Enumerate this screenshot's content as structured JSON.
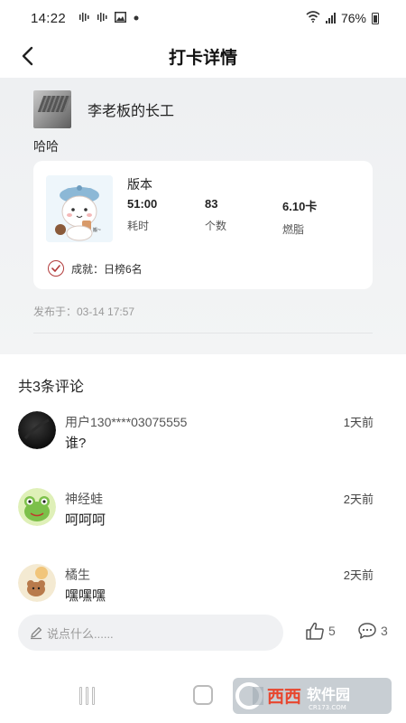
{
  "status_bar": {
    "time": "14:22",
    "icons_left": [
      "notification-icon",
      "notification-icon",
      "gallery-icon",
      "dot-icon"
    ],
    "icons_right": [
      "wifi-icon",
      "signal-icon"
    ],
    "battery": "76%"
  },
  "header": {
    "title": "打卡详情",
    "back_icon": "chevron-left-icon"
  },
  "post": {
    "author": "李老板的长工",
    "text": "哈哈",
    "record": {
      "name": "版本",
      "stats": [
        {
          "value": "51:00",
          "label": "耗时"
        },
        {
          "value": "83",
          "label": "个数"
        },
        {
          "value": "6.10卡",
          "label": "燃脂"
        }
      ],
      "achievement": "成就：日榜6名"
    },
    "published": "发布于：03-14 17:57"
  },
  "comments": {
    "title": "共3条评论",
    "items": [
      {
        "user": "用户130****03075555",
        "text": "谁?",
        "time": "1天前"
      },
      {
        "user": "神经蛙",
        "text": "呵呵呵",
        "time": "2天前"
      },
      {
        "user": "橘生",
        "text": "嘿嘿嘿",
        "time": "2天前"
      }
    ]
  },
  "bottom_bar": {
    "input_placeholder": "说点什么......",
    "likes": "5",
    "comment_count": "3"
  },
  "watermark": {
    "site": "CR173.COM",
    "brand": "西西软件园"
  },
  "colors": {
    "accent_red": "#b23b3b",
    "background_gray": "#eef0f2",
    "text_dark": "#222222"
  }
}
